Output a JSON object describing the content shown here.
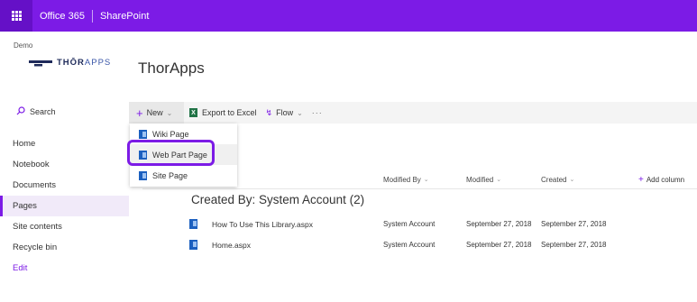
{
  "suite_bar": {
    "app_name": "Office 365",
    "site_product": "SharePoint",
    "color": "#7c1be6"
  },
  "header": {
    "site_label": "Demo",
    "logo_text_bold": "THŌR",
    "logo_text_light": "APPS",
    "site_title": "ThorApps"
  },
  "search": {
    "label": "Search",
    "icon": "search-icon"
  },
  "left_nav": {
    "items": [
      {
        "label": "Home"
      },
      {
        "label": "Notebook"
      },
      {
        "label": "Documents"
      },
      {
        "label": "Pages",
        "active": true
      },
      {
        "label": "Site contents"
      },
      {
        "label": "Recycle bin"
      },
      {
        "label": "Edit"
      }
    ]
  },
  "command_bar": {
    "new_label": "New",
    "excel_label": "Export to Excel",
    "flow_label": "Flow",
    "more_label": "···"
  },
  "new_menu": {
    "items": [
      {
        "label": "Wiki Page"
      },
      {
        "label": "Web Part Page",
        "highlighted": true
      },
      {
        "label": "Site Page"
      }
    ]
  },
  "columns": {
    "modified_by": "Modified By",
    "modified": "Modified",
    "created": "Created",
    "add_column": "Add column"
  },
  "group": {
    "title": "Created By: System Account (2)"
  },
  "rows": [
    {
      "name": "How To Use This Library.aspx",
      "modified_by": "System Account",
      "modified": "September 27, 2018",
      "created": "September 27, 2018"
    },
    {
      "name": "Home.aspx",
      "modified_by": "System Account",
      "modified": "September 27, 2018",
      "created": "September 27, 2018"
    }
  ]
}
